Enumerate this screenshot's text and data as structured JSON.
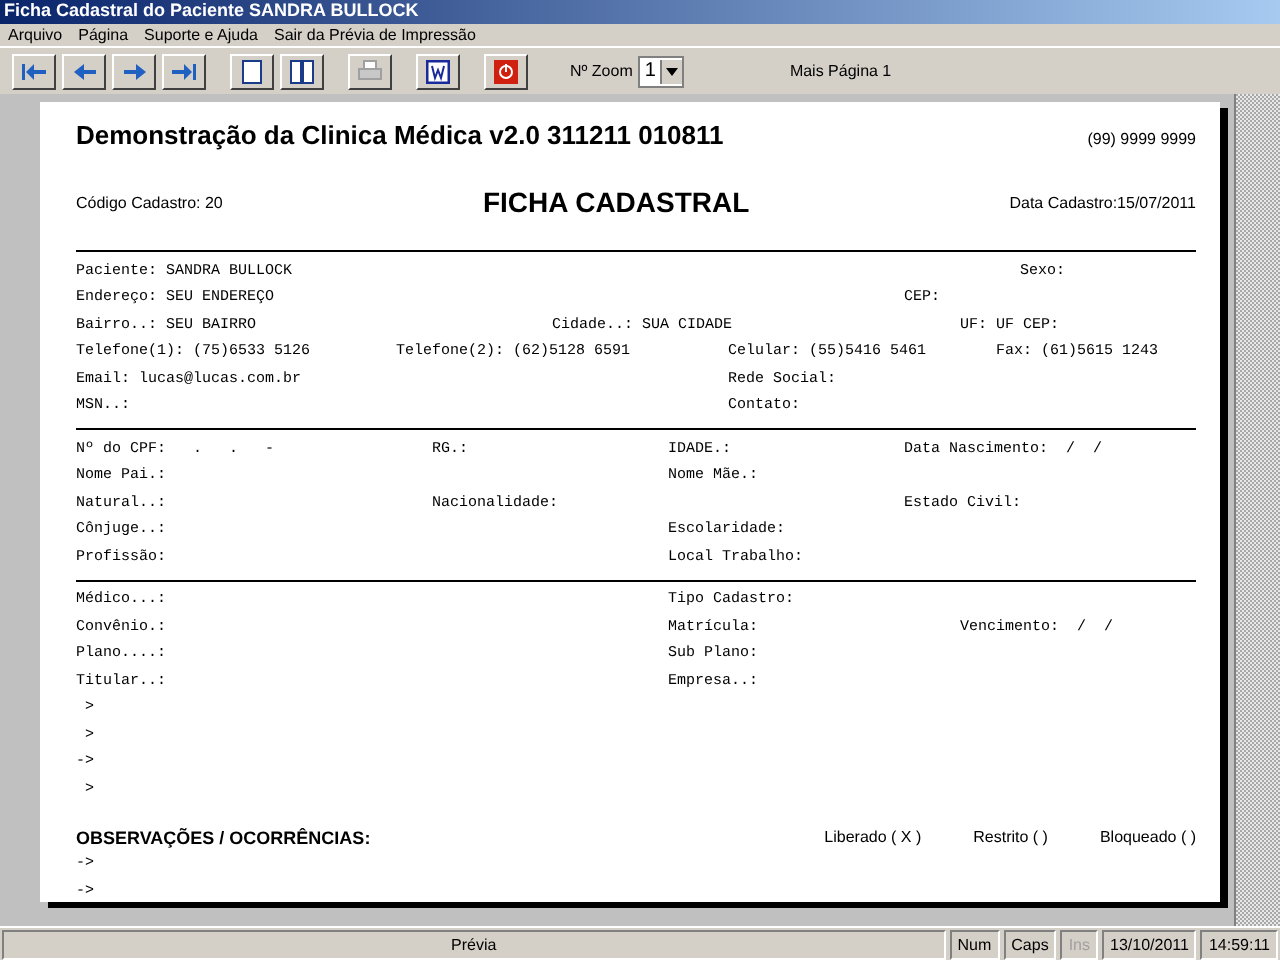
{
  "window": {
    "title": "Ficha Cadastral do Paciente SANDRA BULLOCK"
  },
  "menu": [
    "Arquivo",
    "Página",
    "Suporte e Ajuda",
    "Sair da Prévia de Impressão"
  ],
  "toolbar": {
    "zoom_label": "Nº Zoom",
    "zoom_value": "1",
    "page_label": "Mais Página 1"
  },
  "page": {
    "title": "Demonstração da Clinica Médica v2.0 311211 010811",
    "phone": "(99) 9999 9999",
    "code": "Código Cadastro:   20",
    "heading": "FICHA CADASTRAL",
    "date": "Data Cadastro:15/07/2011",
    "sections": [
      [
        [
          "Paciente: SANDRA BULLOCK",
          "Sexo:"
        ],
        [
          "Endereço: SEU ENDEREÇO",
          "CEP:"
        ],
        [
          "Bairro..: SEU BAIRRO",
          "Cidade..: SUA CIDADE",
          "UF: UF CEP:"
        ],
        [
          "Telefone(1): (75)6533 5126",
          "Telefone(2): (62)5128 6591",
          "Celular: (55)5416 5461",
          "Fax: (61)5615 1243"
        ],
        [
          "Email: lucas@lucas.com.br",
          "Rede Social:"
        ],
        [
          "MSN..:",
          "Contato:"
        ]
      ],
      [
        [
          "Nº do CPF:   .   .   -",
          "RG.:",
          "IDADE.:",
          "Data Nascimento:  /  /"
        ],
        [
          "Nome Pai.:",
          "Nome Mãe.:"
        ],
        [
          "Natural..:",
          "Nacionalidade:",
          "Estado Civil:"
        ],
        [
          "Cônjuge..:",
          "Escolaridade:"
        ],
        [
          "Profissão:",
          "Local Trabalho:"
        ]
      ],
      [
        [
          "Médico...:",
          "Tipo Cadastro:"
        ],
        [
          "Convênio.:",
          "Matrícula:",
          "Vencimento:  /  /"
        ],
        [
          "Plano....:",
          "Sub Plano:"
        ],
        [
          "Titular..:",
          "Empresa..:"
        ]
      ]
    ],
    "arrows": [
      " >",
      " >",
      "->",
      " >"
    ],
    "observations": {
      "label": "OBSERVAÇÕES / OCORRÊNCIAS:",
      "options": [
        "Liberado ( X )",
        "Restrito (  )",
        "Bloqueado (  )"
      ],
      "arrows": [
        "->",
        "->"
      ]
    }
  },
  "status_bar": [
    {
      "text": "Prévia",
      "disabled": false
    },
    {
      "text": "Num",
      "disabled": false
    },
    {
      "text": "Caps",
      "disabled": false
    },
    {
      "text": "Ins",
      "disabled": true
    },
    {
      "text": "13/10/2011",
      "disabled": false
    },
    {
      "text": "14:59:11",
      "disabled": false
    }
  ]
}
